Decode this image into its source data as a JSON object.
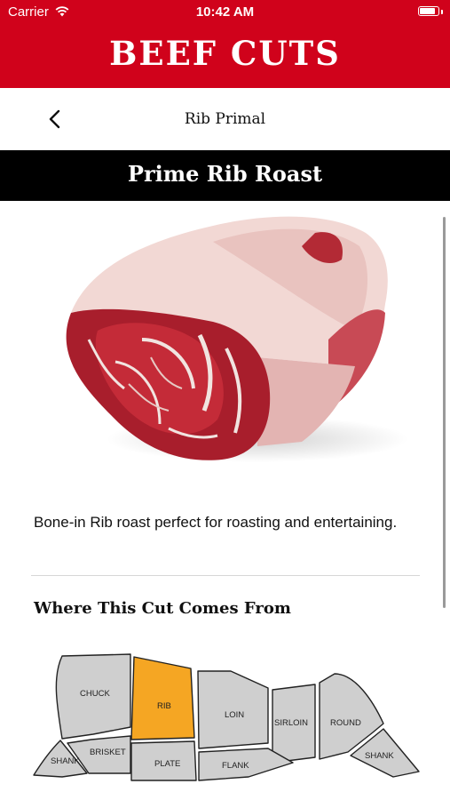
{
  "status_bar": {
    "carrier": "Carrier",
    "time": "10:42 AM",
    "battery_level": 0.9
  },
  "header": {
    "title": "BEEF CUTS"
  },
  "nav": {
    "title": "Rib Primal",
    "back_icon": "chevron-left-icon"
  },
  "cut": {
    "name": "Prime Rib Roast",
    "description": "Bone-in Rib roast perfect for roasting and entertaining."
  },
  "map": {
    "heading": "Where This Cut Comes From",
    "highlight_color": "#f5a623",
    "selected": "RIB",
    "labels": {
      "chuck": "CHUCK",
      "rib": "RIB",
      "loin": "LOIN",
      "sirloin": "SIRLOIN",
      "round": "ROUND",
      "brisket": "BRISKET",
      "plate": "PLATE",
      "flank": "FLANK",
      "shank_front": "SHANK",
      "shank_rear": "SHANK"
    }
  },
  "colors": {
    "brand_red": "#d0021b",
    "bar_black": "#000000"
  }
}
